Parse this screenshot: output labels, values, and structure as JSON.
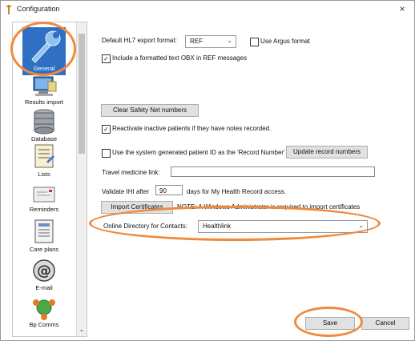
{
  "window": {
    "title": "Configuration",
    "close_glyph": "×"
  },
  "sidebar": {
    "items": [
      {
        "label": "General",
        "icon": "wrench-icon"
      },
      {
        "label": "Results import",
        "icon": "computer-icon"
      },
      {
        "label": "Database",
        "icon": "database-icon"
      },
      {
        "label": "Lists",
        "icon": "list-icon"
      },
      {
        "label": "Reminders",
        "icon": "reminder-icon"
      },
      {
        "label": "Care plans",
        "icon": "care-plan-icon"
      },
      {
        "label": "E-mail",
        "icon": "at-sign-icon"
      },
      {
        "label": "Bp Comms",
        "icon": "network-icon"
      }
    ],
    "scroll_down_glyph": "⌄"
  },
  "general": {
    "hl7_format_label": "Default HL7 export format:",
    "hl7_format_value": "REF",
    "argus_label": "Use Argus format",
    "argus_checked": false,
    "obx_label": "Include a formatted text OBX in REF messages",
    "obx_checked": true,
    "clear_safety_net_label": "Clear Safety Net numbers",
    "reactivate_label": "Reactivate inactive patients if they have notes recorded.",
    "reactivate_checked": true,
    "system_id_label": "Use the system generated patient ID as the 'Record Number'",
    "system_id_checked": false,
    "update_records_label": "Update record numbers",
    "travel_label": "Travel medicine link:",
    "travel_value": "",
    "ihi_label": "Validate IHI after",
    "ihi_value": "90",
    "ihi_suffix": "days for My Health Record access.",
    "import_certificates_label": "Import Certificates",
    "certificates_note": "NOTE: A Windows Administrator is required to import certificates",
    "online_directory_label": "Online Directory for Contacts:",
    "online_directory_value": "Healthlink",
    "check_glyph": "✓",
    "dropdown_glyph": "⌄"
  },
  "footer": {
    "save_label": "Save",
    "cancel_label": "Cancel"
  },
  "colors": {
    "annotation": "#f08a3c",
    "selection": "#2f6fc4"
  }
}
